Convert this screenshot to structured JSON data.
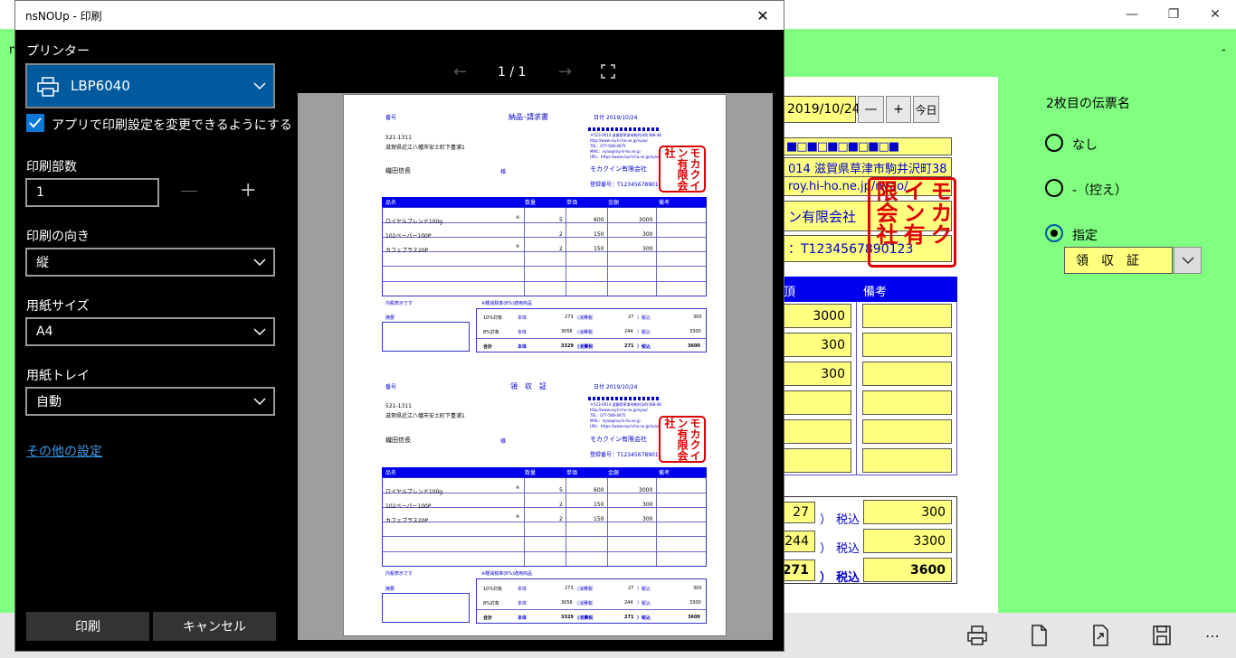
{
  "app": {
    "bg_title": "",
    "bg_tab_marker": "n",
    "bg_dash": "-"
  },
  "bg": {
    "date_value": "2019/10/24",
    "minus_label": "—",
    "plus_label": "+",
    "today_label": "今日",
    "sender_dots_top": "■□■□■□■□■□■",
    "sender_address": "014 滋賀県草津市駒井沢町38",
    "sender_url": "roy.hi-ho.ne.jp/nyao/",
    "sender_company": "ン有限会社",
    "sender_reg": "：T1234567890123",
    "stamp_text": "モカクイン有限会社",
    "table_header_amount": "頂",
    "table_header_note": "備考",
    "amounts": [
      "3000",
      "300",
      "300"
    ],
    "tax10": "27",
    "tax8": "244",
    "tax_total": "271",
    "paren": "）",
    "incl_label": "税込",
    "incl10": "300",
    "incl8": "3300",
    "incl_total": "3600",
    "second_slip_label": "2枚目の伝票名",
    "radio_none": "なし",
    "radio_copy": "-（控え）",
    "radio_custom": "指定",
    "custom_value": "領　収　証"
  },
  "dialog": {
    "title": "nsNOUp - 印刷",
    "printer_label": "プリンター",
    "printer_value": "LBP6040",
    "allow_app_settings": "アプリで印刷設定を変更できるようにする",
    "copies_label": "印刷部数",
    "copies_value": "1",
    "orientation_label": "印刷の向き",
    "orientation_value": "縦",
    "paper_size_label": "用紙サイズ",
    "paper_size_value": "A4",
    "paper_tray_label": "用紙トレイ",
    "paper_tray_value": "自動",
    "more_settings": "その他の設定",
    "print_button": "印刷",
    "cancel_button": "キャンセル",
    "page_indicator": "1 / 1"
  },
  "preview": {
    "number_label": "番号",
    "title1": "納品･請求書",
    "title2": "領　収　証",
    "date": "日付 2019/10/24",
    "zip": "521-1311",
    "address": "滋賀県近江八幡市安土町下豊浦1",
    "customer": "織田信長",
    "sama": "様",
    "company": "モカクイン有限会社",
    "reg_no": "登録番号：T1234567890123",
    "sender_small_1": "〒523-0014 滋賀県草津市駒井沢町388-48",
    "sender_small_2": "http://www.roy.hi-ho.ne.jp/nyao/",
    "sender_small_3": "TEL：077-568-4675",
    "sender_small_4": "MAIL：nyao@roy.hi-ho.ne.jp",
    "sender_small_5": "URL：https://www.roy.hi-ho.ne.jp/nyao/",
    "headers": [
      "品名",
      "数量",
      "単価",
      "金額",
      "備考"
    ],
    "rows": [
      {
        "name": "ロイヤルブレンド100g",
        "mark": "※",
        "qty": "5",
        "price": "600",
        "amount": "3000"
      },
      {
        "name": "102ペーパー100P",
        "mark": "",
        "qty": "2",
        "price": "150",
        "amount": "300"
      },
      {
        "name": "カフェプラス20P",
        "mark": "※",
        "qty": "2",
        "price": "150",
        "amount": "300"
      }
    ],
    "tax_display": "内税表示です",
    "reduced_note": "※軽減税率(8%)適用商品",
    "memo_label": "摘要",
    "sum_rows": [
      {
        "label": "10%対象",
        "body": "本体",
        "base": "273",
        "tax_label": "(消費税",
        "tax": "27",
        "incl_label": "）税込",
        "incl": "300"
      },
      {
        "label": "8%対象",
        "body": "本体",
        "base": "3056",
        "tax_label": "(消費税",
        "tax": "244",
        "incl_label": "）税込",
        "incl": "3300"
      },
      {
        "label": "合計",
        "body": "本体",
        "base": "3329",
        "tax_label": "(消費税",
        "tax": "271",
        "incl_label": "）税込",
        "incl": "3600"
      }
    ]
  },
  "colors": {
    "bg_green": "#80ff80",
    "yellow_field": "#ffff80",
    "accent_blue": "#005a9e",
    "slip_blue": "#0000ee",
    "stamp_red": "#dd0000"
  },
  "icons": {
    "toolbar": [
      "printer-icon",
      "new-document-icon",
      "export-icon",
      "save-icon",
      "more-icon"
    ]
  }
}
